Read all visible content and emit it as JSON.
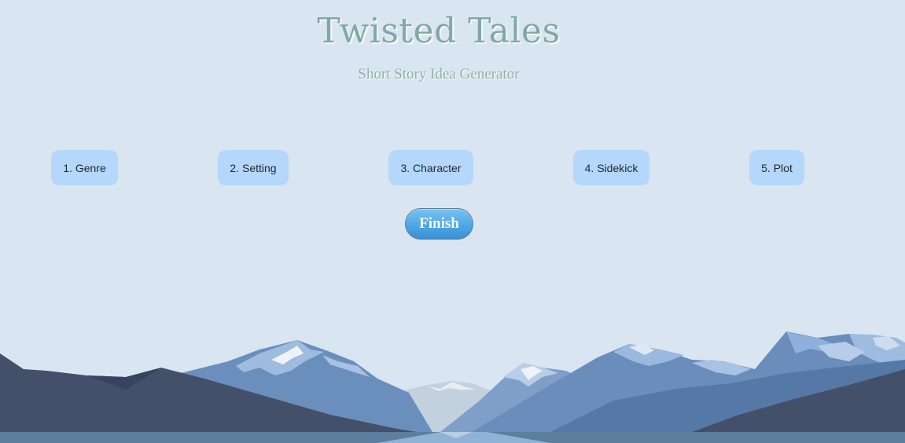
{
  "header": {
    "title": "Twisted Tales",
    "subtitle": "Short Story Idea Generator"
  },
  "steps": [
    {
      "label": "1. Genre"
    },
    {
      "label": "2. Setting"
    },
    {
      "label": "3. Character"
    },
    {
      "label": "4. Sidekick"
    },
    {
      "label": "5. Plot"
    }
  ],
  "actions": {
    "finish_label": "Finish"
  },
  "colors": {
    "background": "#d9e5f1",
    "step_button": "#b5d7fb",
    "finish_button": "#4fa6e6",
    "title": "#7fa8a6"
  }
}
